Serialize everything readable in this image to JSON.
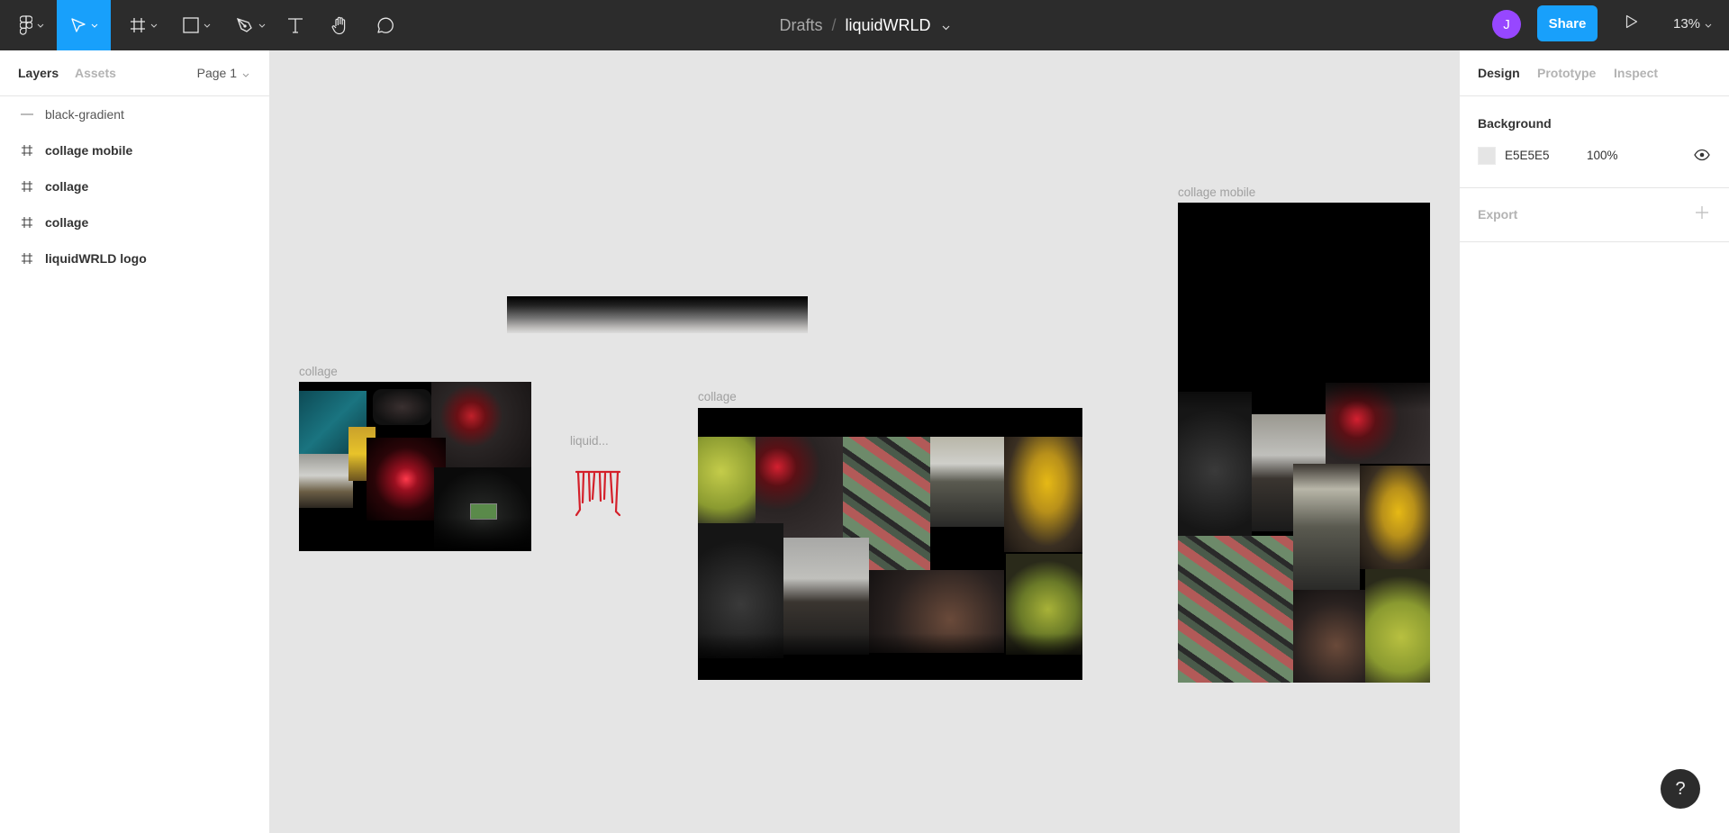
{
  "toolbar": {
    "tools": [
      {
        "name": "main-menu",
        "icon": "figma-logo-icon",
        "has_dropdown": true
      },
      {
        "name": "move-tool",
        "icon": "cursor-arrow-icon",
        "has_dropdown": true,
        "active": true
      },
      {
        "name": "frame-tool",
        "icon": "frame-hash-icon",
        "has_dropdown": true
      },
      {
        "name": "shape-tool",
        "icon": "rectangle-icon",
        "has_dropdown": true
      },
      {
        "name": "pen-tool",
        "icon": "pen-nib-icon",
        "has_dropdown": true
      },
      {
        "name": "text-tool",
        "icon": "text-t-icon",
        "has_dropdown": false
      },
      {
        "name": "hand-tool",
        "icon": "hand-icon",
        "has_dropdown": false
      },
      {
        "name": "comment-tool",
        "icon": "comment-bubble-icon",
        "has_dropdown": false
      }
    ],
    "breadcrumb": {
      "folder": "Drafts",
      "separator": "/",
      "file": "liquidWRLD"
    },
    "avatar_initial": "J",
    "share_label": "Share",
    "zoom_level": "13%",
    "accent_color": "#18a0fb",
    "avatar_color": "#9747ff"
  },
  "left_panel": {
    "tabs": [
      {
        "label": "Layers",
        "active": true
      },
      {
        "label": "Assets",
        "active": false
      }
    ],
    "page_selector": "Page 1",
    "layers": [
      {
        "name": "black-gradient",
        "icon": "line-icon"
      },
      {
        "name": "collage mobile",
        "icon": "frame-hash-icon"
      },
      {
        "name": "collage",
        "icon": "frame-hash-icon"
      },
      {
        "name": "collage",
        "icon": "frame-hash-icon"
      },
      {
        "name": "liquidWRLD logo",
        "icon": "frame-hash-icon"
      }
    ]
  },
  "right_panel": {
    "tabs": [
      {
        "label": "Design",
        "active": true
      },
      {
        "label": "Prototype",
        "active": false
      },
      {
        "label": "Inspect",
        "active": false
      }
    ],
    "background": {
      "title": "Background",
      "hex": "E5E5E5",
      "opacity": "100%",
      "color": "#e5e5e5"
    },
    "export": {
      "title": "Export"
    }
  },
  "canvas": {
    "frames": [
      {
        "label": "collage",
        "id": "collage-left"
      },
      {
        "label": "liquid...",
        "id": "logo"
      },
      {
        "label": "collage",
        "id": "collage-center"
      },
      {
        "label": "collage mobile",
        "id": "collage-mobile"
      }
    ],
    "logo_text": "LIQUIDWRLD"
  },
  "help_label": "?"
}
